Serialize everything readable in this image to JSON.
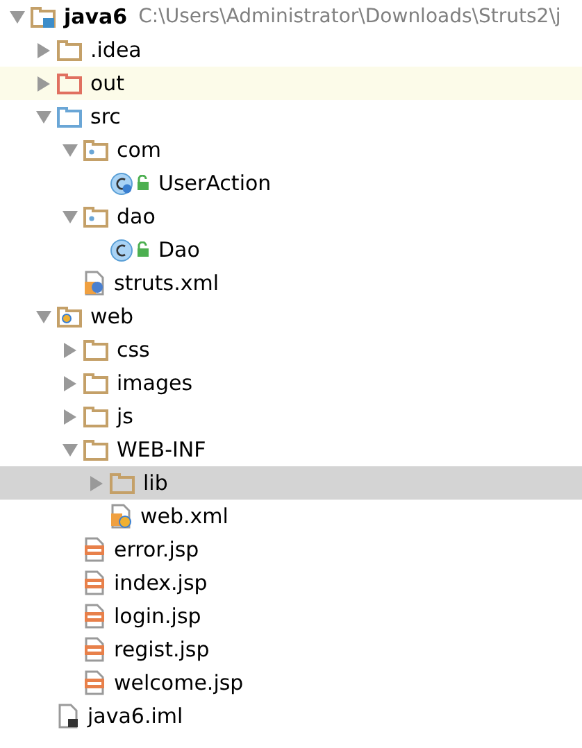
{
  "project_tree": [
    {
      "label": "java6",
      "path": "C:\\Users\\Administrator\\Downloads\\Struts2\\j",
      "kind": "module",
      "expanded": true,
      "selected": false,
      "highlighted": false,
      "children": [
        {
          "label": ".idea",
          "kind": "folder",
          "expanded": false,
          "selected": false,
          "highlighted": false
        },
        {
          "label": "out",
          "kind": "excluded-folder",
          "expanded": false,
          "selected": false,
          "highlighted": true
        },
        {
          "label": "src",
          "kind": "source-folder",
          "expanded": true,
          "selected": false,
          "highlighted": false,
          "children": [
            {
              "label": "com",
              "kind": "package",
              "expanded": true,
              "selected": false,
              "highlighted": false,
              "children": [
                {
                  "label": "UserAction",
                  "kind": "action-class",
                  "selected": false,
                  "highlighted": false
                }
              ]
            },
            {
              "label": "dao",
              "kind": "package",
              "expanded": true,
              "selected": false,
              "highlighted": false,
              "children": [
                {
                  "label": "Dao",
                  "kind": "class",
                  "selected": false,
                  "highlighted": false
                }
              ]
            },
            {
              "label": "struts.xml",
              "kind": "struts-xml",
              "selected": false,
              "highlighted": false
            }
          ]
        },
        {
          "label": "web",
          "kind": "web-folder",
          "expanded": true,
          "selected": false,
          "highlighted": false,
          "children": [
            {
              "label": "css",
              "kind": "folder",
              "expanded": false,
              "selected": false,
              "highlighted": false
            },
            {
              "label": "images",
              "kind": "folder",
              "expanded": false,
              "selected": false,
              "highlighted": false
            },
            {
              "label": "js",
              "kind": "folder",
              "expanded": false,
              "selected": false,
              "highlighted": false
            },
            {
              "label": "WEB-INF",
              "kind": "folder",
              "expanded": true,
              "selected": false,
              "highlighted": false,
              "children": [
                {
                  "label": "lib",
                  "kind": "folder",
                  "expanded": false,
                  "selected": true,
                  "highlighted": false
                },
                {
                  "label": "web.xml",
                  "kind": "web-xml",
                  "selected": false,
                  "highlighted": false
                }
              ]
            },
            {
              "label": "error.jsp",
              "kind": "jsp",
              "selected": false,
              "highlighted": false
            },
            {
              "label": "index.jsp",
              "kind": "jsp",
              "selected": false,
              "highlighted": false
            },
            {
              "label": "login.jsp",
              "kind": "jsp",
              "selected": false,
              "highlighted": false
            },
            {
              "label": "regist.jsp",
              "kind": "jsp",
              "selected": false,
              "highlighted": false
            },
            {
              "label": "welcome.jsp",
              "kind": "jsp",
              "selected": false,
              "highlighted": false
            }
          ]
        },
        {
          "label": "java6.iml",
          "kind": "iml",
          "selected": false,
          "highlighted": false
        }
      ]
    }
  ]
}
